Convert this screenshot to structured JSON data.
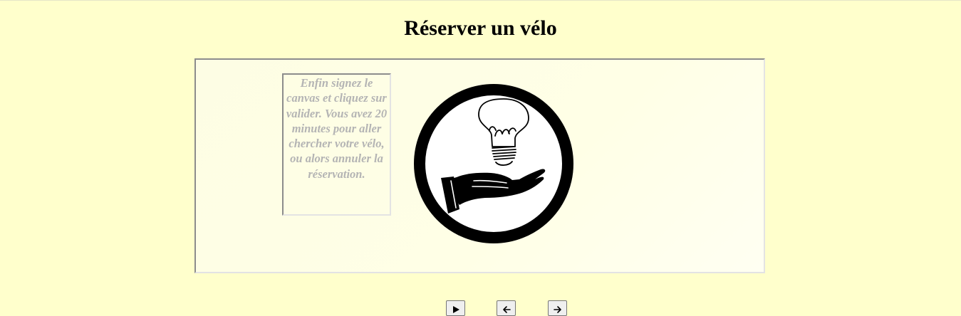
{
  "page": {
    "title": "Réserver un vélo"
  },
  "slideshow": {
    "caption": "Enfin signez le canvas et cliquez sur valider. Vous avez 20 minutes pour aller chercher votre vélo, ou alors annuler la réservation.",
    "illustration_icon": "hand-lightbulb-icon"
  },
  "controls": {
    "play_icon": "play-icon",
    "prev_icon": "arrow-left-icon",
    "next_icon": "arrow-right-icon"
  },
  "colors": {
    "background": "#ffffcc",
    "caption_text": "#b4b4b4"
  }
}
